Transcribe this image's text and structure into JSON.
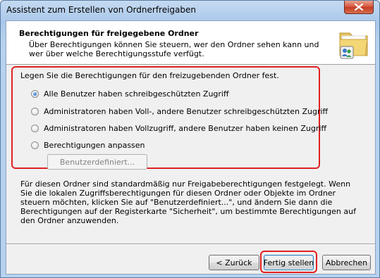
{
  "window": {
    "title": "Assistent zum Erstellen von Ordnerfreigaben"
  },
  "header": {
    "title": "Berechtigungen für freigegebene Ordner",
    "description": "Über Berechtigungen können Sie steuern, wer den Ordner sehen kann und wer über welche Berechtigungsstufe verfügt."
  },
  "permissions": {
    "intro": "Legen Sie die Berechtigungen für den freizugebenden Ordner fest.",
    "options": [
      {
        "label": "Alle Benutzer haben schreibgeschützten Zugriff",
        "checked": true
      },
      {
        "label": "Administratoren haben Voll-, andere Benutzer schreibgeschützten Zugriff",
        "checked": false
      },
      {
        "label": "Administratoren haben Vollzugriff, andere Benutzer haben keinen Zugriff",
        "checked": false
      },
      {
        "label": "Berechtigungen anpassen",
        "checked": false
      }
    ],
    "custom_button": "Benutzerdefiniert..."
  },
  "info": "Für diesen Ordner sind standardmäßig nur Freigabeberechtigungen festgelegt. Wenn Sie die lokalen Zugriffsberechtigungen für diesen Ordner oder Objekte im Ordner steuern möchten, klicken Sie auf \"Benutzerdefiniert...\", und ändern Sie dann die Berechtigungen auf der Registerkarte \"Sicherheit\", um bestimmte Berechtigungen auf den Ordner anzuwenden.",
  "buttons": {
    "back": "< Zurück",
    "finish": "Fertig stellen",
    "cancel": "Abbrechen"
  },
  "icons": {
    "close": "close-icon",
    "folder": "shared-folder-icon"
  },
  "colors": {
    "annotation": "#e02020",
    "titlebar": "#b7d2ef"
  }
}
